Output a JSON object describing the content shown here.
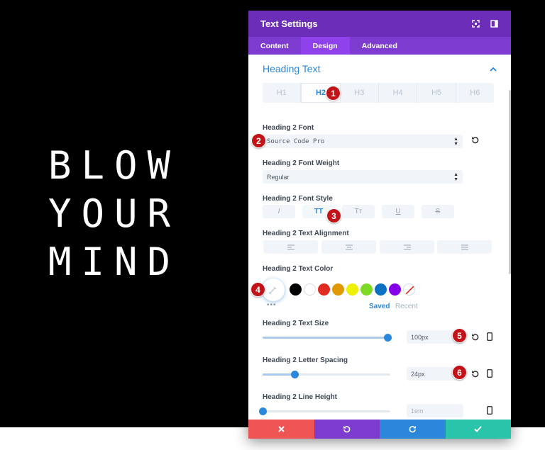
{
  "hero": {
    "lines": [
      "BLOW",
      "YOUR",
      "MIND"
    ]
  },
  "modal": {
    "title": "Text Settings",
    "tabs": [
      "Content",
      "Design",
      "Advanced"
    ],
    "active_tab": "Design",
    "section_title": "Heading Text",
    "heading_tabs": [
      "H1",
      "H2",
      "H3",
      "H4",
      "H5",
      "H6"
    ],
    "active_heading": "H2"
  },
  "fields": {
    "font_label": "Heading 2 Font",
    "font_value": "Source Code Pro",
    "weight_label": "Heading 2 Font Weight",
    "weight_value": "Regular",
    "style_label": "Heading 2 Font Style",
    "style_buttons": [
      "I",
      "TT",
      "Tт",
      "U",
      "S"
    ],
    "align_label": "Heading 2 Text Alignment",
    "color_label": "Heading 2 Text Color",
    "swatches": [
      "#000000",
      "#ffffff",
      "#e02b20",
      "#e09900",
      "#edf000",
      "#7cda24",
      "#0c71c3",
      "#8300e9"
    ],
    "saved_label": "Saved",
    "recent_label": "Recent",
    "size_label": "Heading 2 Text Size",
    "size_value": "100px",
    "size_fraction": 0.98,
    "spacing_label": "Heading 2 Letter Spacing",
    "spacing_value": "24px",
    "spacing_fraction": 0.25,
    "lineheight_label": "Heading 2 Line Height",
    "lineheight_value": "1em",
    "lineheight_fraction": 0.0
  },
  "markers": [
    "1",
    "2",
    "3",
    "4",
    "5",
    "6"
  ],
  "colors": {
    "accent": "#2b87da",
    "titlebar": "#6c2eb9",
    "tabs": "#7e3bd0",
    "marker": "#c11318",
    "cancel": "#ef5555",
    "undo": "#7e3bd0",
    "redo": "#2b87da",
    "save": "#29c4a9"
  },
  "icons": {
    "titlebar": [
      "fullscreen-icon",
      "sidebar-toggle-icon"
    ],
    "footer": [
      "close-icon",
      "undo-icon",
      "redo-icon",
      "check-icon"
    ]
  }
}
